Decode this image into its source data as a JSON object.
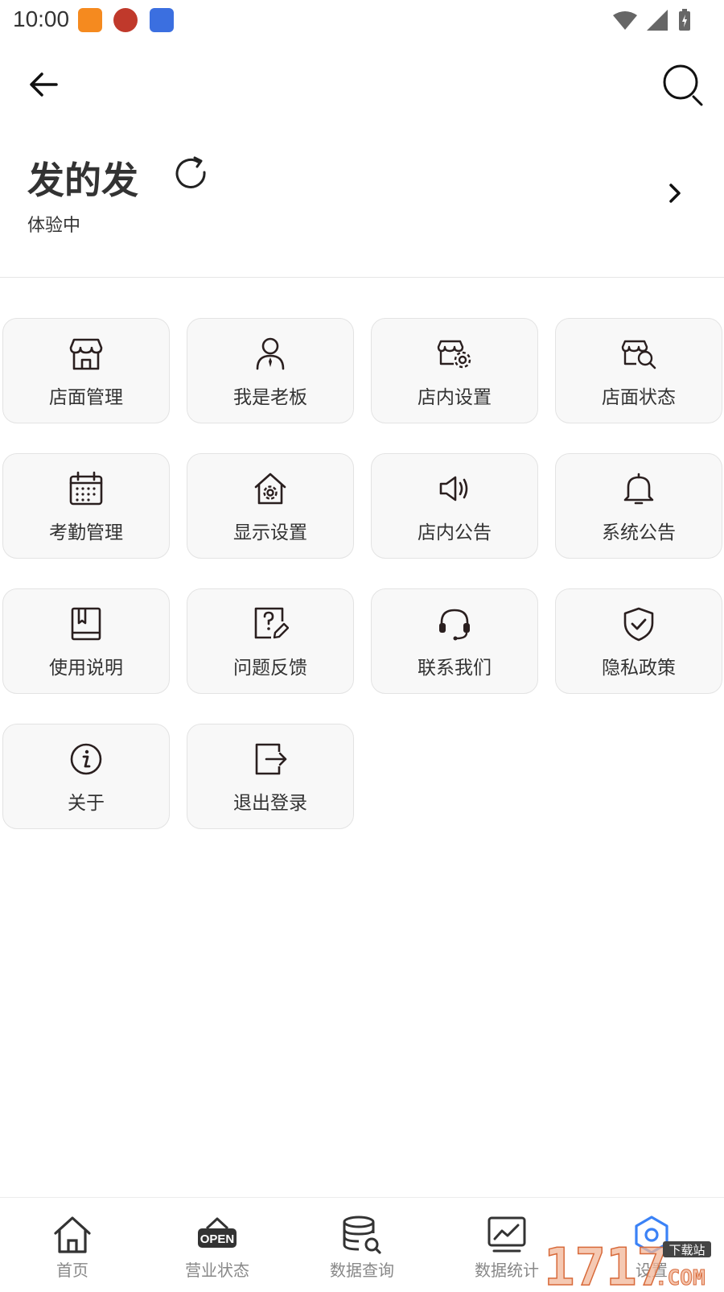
{
  "status_bar": {
    "time": "10:00"
  },
  "header": {
    "back_icon": "arrow-left-icon",
    "search_icon": "search-icon"
  },
  "profile": {
    "store_name": "发的发",
    "status": "体验中"
  },
  "menu": [
    {
      "label": "店面管理",
      "icon": "storefront-icon"
    },
    {
      "label": "我是老板",
      "icon": "person-icon"
    },
    {
      "label": "店内设置",
      "icon": "store-settings-icon"
    },
    {
      "label": "店面状态",
      "icon": "store-search-icon"
    },
    {
      "label": "考勤管理",
      "icon": "calendar-icon"
    },
    {
      "label": "显示设置",
      "icon": "home-gear-icon"
    },
    {
      "label": "店内公告",
      "icon": "speaker-icon"
    },
    {
      "label": "系统公告",
      "icon": "bell-icon"
    },
    {
      "label": "使用说明",
      "icon": "book-icon"
    },
    {
      "label": "问题反馈",
      "icon": "question-edit-icon"
    },
    {
      "label": "联系我们",
      "icon": "headset-icon"
    },
    {
      "label": "隐私政策",
      "icon": "shield-check-icon"
    },
    {
      "label": "关于",
      "icon": "info-icon"
    },
    {
      "label": "退出登录",
      "icon": "logout-icon"
    }
  ],
  "bottom_nav": [
    {
      "label": "首页",
      "icon": "home-icon"
    },
    {
      "label": "营业状态",
      "icon": "open-sign-icon",
      "badge_text": "OPEN"
    },
    {
      "label": "数据查询",
      "icon": "database-search-icon"
    },
    {
      "label": "数据统计",
      "icon": "chart-icon"
    },
    {
      "label": "设置",
      "icon": "settings-icon",
      "active": true
    }
  ],
  "colors": {
    "accent": "#3b82f6",
    "text": "#333333",
    "nav_text": "#888888",
    "tile_bg": "#f8f8f8"
  },
  "watermark": {
    "text": "1717",
    "suffix": ".COM",
    "tag": "下载站"
  }
}
